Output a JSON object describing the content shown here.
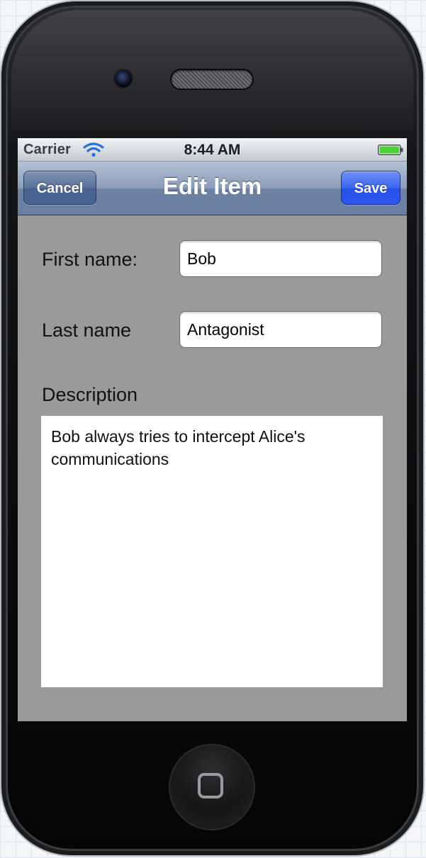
{
  "status_bar": {
    "carrier": "Carrier",
    "time": "8:44 AM",
    "wifi_icon": "wifi-icon",
    "battery_icon": "battery-icon",
    "battery_color": "#4cd137"
  },
  "nav_bar": {
    "title": "Edit Item",
    "cancel_label": "Cancel",
    "save_label": "Save",
    "save_color": "#2a57ec"
  },
  "form": {
    "first_name": {
      "label": "First name:",
      "value": "Bob"
    },
    "last_name": {
      "label": "Last name",
      "value": "Antagonist"
    },
    "description": {
      "label": "Description",
      "value": "Bob always tries to intercept Alice's communications"
    }
  },
  "device": {
    "home_button_icon": "home-button-icon",
    "camera_icon": "front-camera-icon",
    "speaker_icon": "speaker-grille-icon"
  }
}
